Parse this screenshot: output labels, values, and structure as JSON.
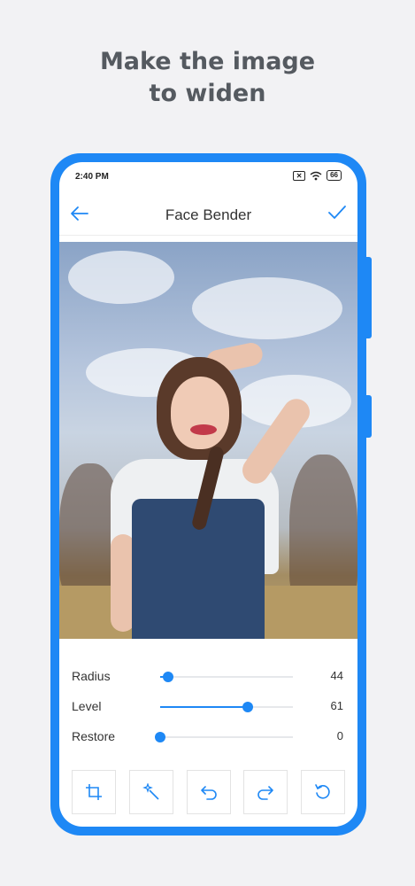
{
  "headline": {
    "line1": "Make the image",
    "line2": "to widen"
  },
  "status": {
    "time": "2:40 PM",
    "battery": "66"
  },
  "appbar": {
    "title": "Face Bender",
    "back_icon": "arrow-left-icon",
    "confirm_icon": "check-icon"
  },
  "sliders": [
    {
      "label": "Radius",
      "value": "44",
      "fraction": 0.06
    },
    {
      "label": "Level",
      "value": "61",
      "fraction": 0.66
    },
    {
      "label": "Restore",
      "value": "0",
      "fraction": 0.0
    }
  ],
  "toolbar": {
    "tools": [
      "crop-icon",
      "magic-wand-icon",
      "undo-icon",
      "redo-icon",
      "reset-icon"
    ]
  },
  "colors": {
    "accent": "#1e88f5",
    "background": "#f2f2f4",
    "headline": "#555a60"
  }
}
